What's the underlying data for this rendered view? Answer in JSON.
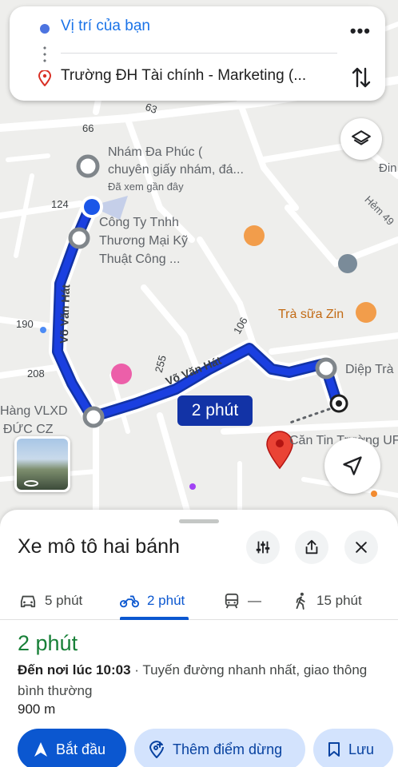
{
  "search": {
    "origin": "Vị trí của bạn",
    "destination": "Trường ĐH Tài chính - Marketing (..."
  },
  "map": {
    "poi_nham_da_phuc": [
      "Nhám Đa Phúc (",
      "chuyên giấy nhám, đá..."
    ],
    "poi_nham_da_phuc_note": "Đã xem gần đây",
    "poi_cong_ty": [
      "Công Ty Tnhh",
      "Thương Mại Kỹ",
      "Thuật Công ..."
    ],
    "poi_tra_sua": "Trà sữa Zin",
    "poi_diep_tra": "Diệp Trà",
    "poi_hang_vlxd": [
      "Hàng VLXD",
      "ĐỨC CZ"
    ],
    "poi_can_tin": "Căn Tin Trường UF",
    "edge_label_dinh": "Đin",
    "edge_label_hem": "Hẻm 49",
    "road_numbers": [
      "63",
      "66",
      "124",
      "190",
      "208",
      "255",
      "106"
    ],
    "road_name": "Võ Văn Hát",
    "route_duration_badge": "2 phút"
  },
  "sheet": {
    "title": "Xe mô tô hai bánh",
    "modes": {
      "car": "5 phút",
      "motorbike": "2 phút",
      "transit": "—",
      "walk": "15 phút"
    },
    "duration": "2 phút",
    "arrival_bold": "Đến nơi lúc 10:03",
    "arrival_rest": " · Tuyến đường nhanh nhất, giao thông bình thường",
    "distance": "900 m",
    "start_label": "Bắt đầu",
    "add_stop_label": "Thêm điểm dừng",
    "save_label": "Lưu"
  },
  "colors": {
    "route": "#1a3fe0",
    "accent": "#0b57d0",
    "duration_green": "#188038",
    "destination_pin": "#ea4335"
  }
}
